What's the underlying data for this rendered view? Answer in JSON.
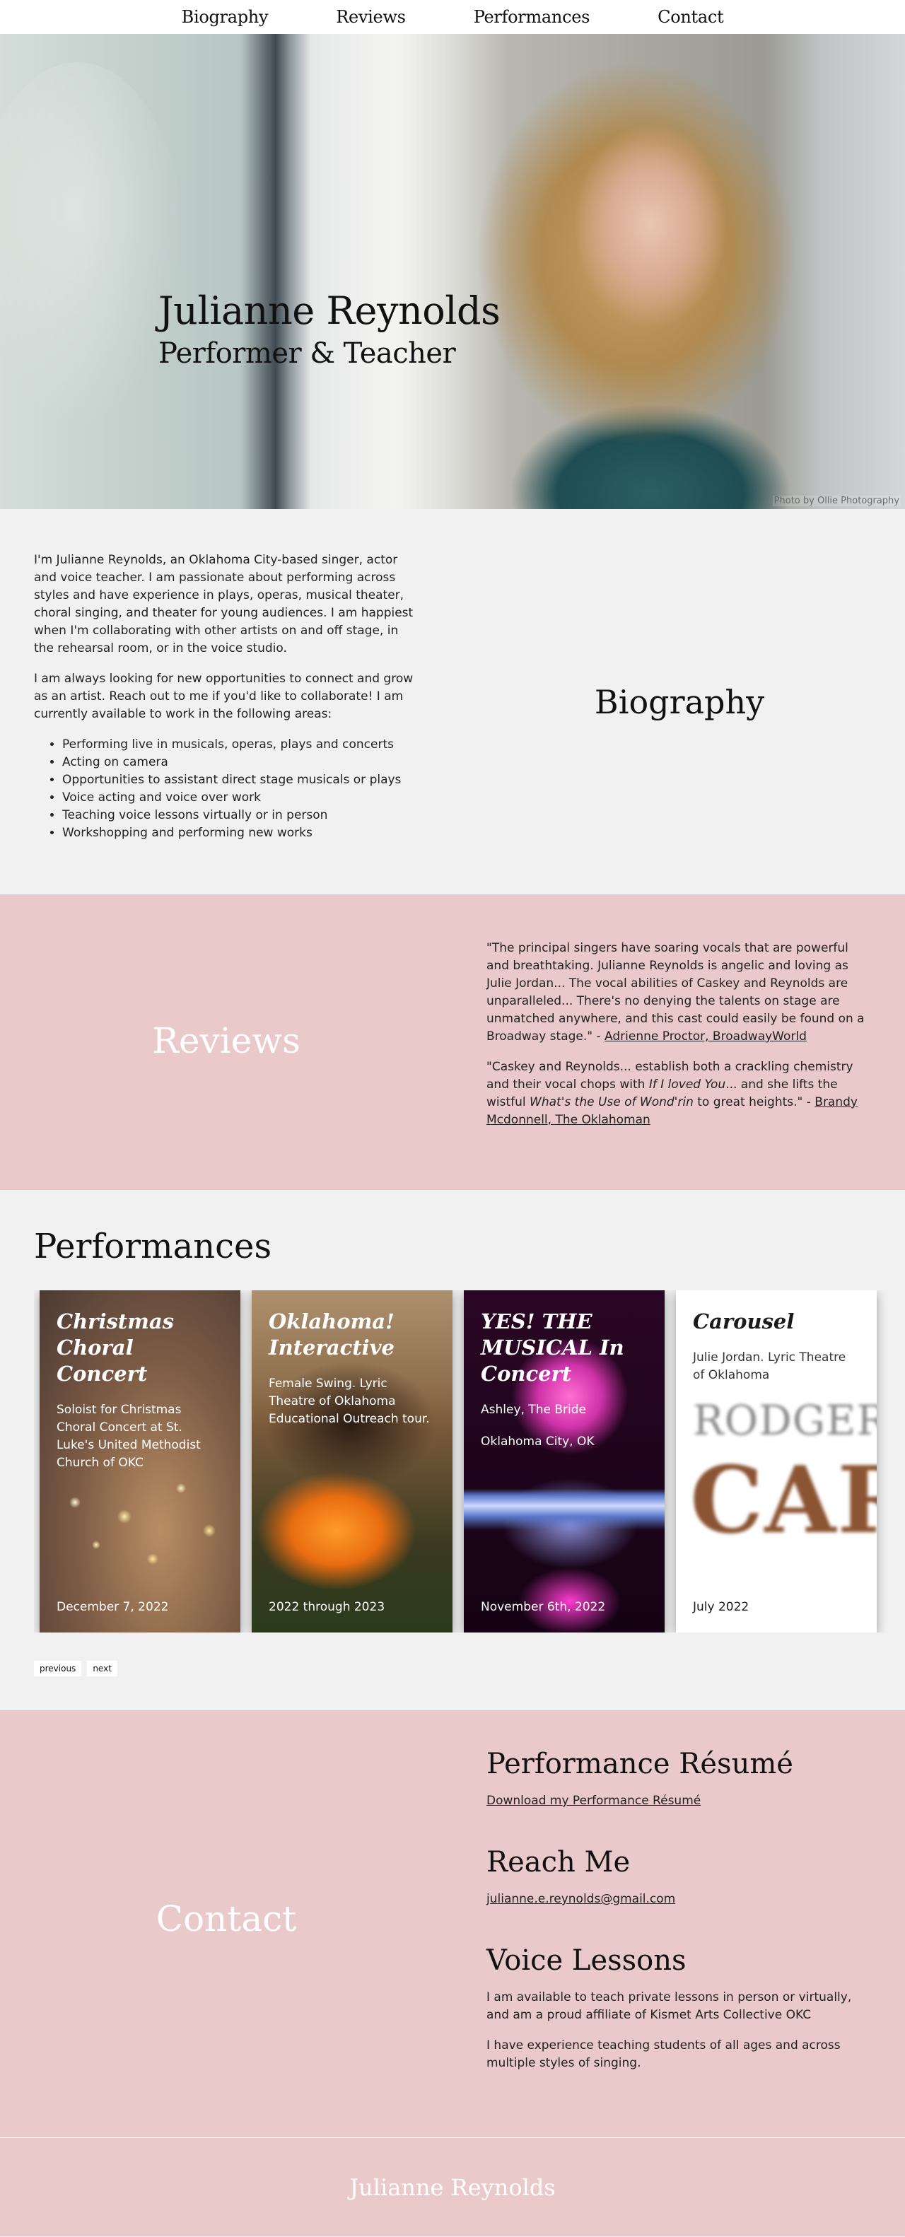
{
  "nav": {
    "items": [
      {
        "label": "Biography"
      },
      {
        "label": "Reviews"
      },
      {
        "label": "Performances"
      },
      {
        "label": "Contact"
      }
    ]
  },
  "hero": {
    "title": "Julianne Reynolds",
    "subtitle": "Performer & Teacher",
    "photo_credit": "Photo by Ollie Photography"
  },
  "biography": {
    "heading": "Biography",
    "paragraphs": [
      "I'm Julianne Reynolds, an Oklahoma City-based singer, actor and voice teacher. I am passionate about performing across styles and have experience in plays, operas, musical theater, choral singing, and theater for young audiences. I am happiest when I'm collaborating with other artists on and off stage, in the rehearsal room, or in the voice studio.",
      "I am always looking for new opportunities to connect and grow as an artist. Reach out to me if you'd like to collaborate! I am currently available to work in the following areas:"
    ],
    "areas": [
      "Performing live in musicals, operas, plays and concerts",
      "Acting on camera",
      "Opportunities to assistant direct stage musicals or plays",
      "Voice acting and voice over work",
      "Teaching voice lessons virtually or in person",
      "Workshopping and performing new works"
    ]
  },
  "reviews": {
    "heading": "Reviews",
    "review1": {
      "quote": "\"The principal singers have soaring vocals that are powerful and breathtaking. Julianne Reynolds is angelic and loving as Julie Jordan... The vocal abilities of Caskey and Reynolds are unparalleled... There's no denying the talents on stage are unmatched anywhere, and this cast could easily be found on a Broadway stage.\" - ",
      "source": "Adrienne Proctor, BroadwayWorld"
    },
    "review2": {
      "part1": "\"Caskey and Reynolds... establish both a crackling chemistry and their vocal chops with ",
      "em1": "If I loved You",
      "part2": "... and she lifts the wistful ",
      "em2": "What's the Use of Wond'rin",
      "part3": " to great heights.\" - ",
      "source": "Brandy Mcdonnell, The Oklahoman"
    }
  },
  "performances": {
    "heading": "Performances",
    "cards": [
      {
        "title": "Christmas Choral Concert",
        "description": "Soloist for Christmas Choral Concert at St. Luke's United Methodist Church of OKC",
        "location": "",
        "date": "December 7, 2022"
      },
      {
        "title": "Oklahoma! Interactive",
        "description": "Female Swing. Lyric Theatre of Oklahoma Educational Outreach tour.",
        "location": "",
        "date": "2022 through 2023"
      },
      {
        "title": "YES! THE MUSICAL In Concert",
        "description": "Ashley, The Bride",
        "location": "Oklahoma City, OK",
        "date": "November 6th, 2022"
      },
      {
        "title": "Carousel",
        "description": "Julie Jordan. Lyric Theatre of Oklahoma",
        "location": "",
        "date": "July 2022"
      }
    ],
    "card4_image_text": {
      "line1": "RODGERS",
      "line2": "CAR"
    },
    "previous_label": "previous",
    "next_label": "next"
  },
  "contact": {
    "heading": "Contact",
    "resume": {
      "heading": "Performance Résumé",
      "link": "Download my Performance Résumé"
    },
    "reach": {
      "heading": "Reach Me",
      "email": "julianne.e.reynolds@gmail.com"
    },
    "lessons": {
      "heading": "Voice Lessons",
      "paragraphs": [
        "I am available to teach private lessons in person or virtually, and am a proud affiliate of Kismet Arts Collective OKC",
        "I have experience teaching students of all ages and across multiple styles of singing."
      ]
    }
  },
  "footer": {
    "name": "Julianne Reynolds"
  },
  "colors": {
    "pink": "#e9c9c9",
    "background": "#f1f1f1",
    "nav": "#ffffff"
  }
}
